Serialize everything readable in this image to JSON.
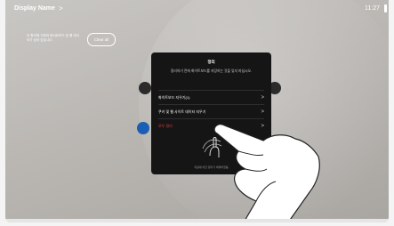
{
  "header": {
    "display_name": "Display Name",
    "chevron": ">",
    "time": "11:27"
  },
  "whiteboard_hint": {
    "text": "이 협석에 기회의 화이트보드 및 웹 데이터가 남아 있습니다.",
    "clear_label": "Clear all"
  },
  "dialog": {
    "title": "정리",
    "description": "정리하기 전에 화이트보드를 저장하는 것을 잊지 마십시오.",
    "items": [
      {
        "label": "화이트보드 지우기(1)",
        "arrow": ">"
      },
      {
        "label": "쿠키 및 웹 사이트 데이터 지우기",
        "arrow": ">"
      },
      {
        "label": "모두 정리",
        "arrow": ">"
      }
    ],
    "footer": "지원에 의한 정리가 해제되었음"
  },
  "colors": {
    "dialog_bg": "#151515",
    "danger": "#e04343",
    "accent": "#1a5fb4"
  },
  "icons": [
    "chevron-right-icon",
    "swipe-gesture-icon",
    "hand-pointer-icon",
    "webex-icon"
  ]
}
